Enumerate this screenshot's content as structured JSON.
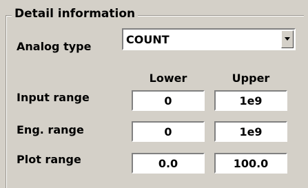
{
  "group": {
    "title": "Detail information"
  },
  "analog_type": {
    "label": "Analog type",
    "value": "COUNT"
  },
  "columns": {
    "lower": "Lower",
    "upper": "Upper"
  },
  "rows": [
    {
      "label": "Input range",
      "lower": "0",
      "upper": "1e9"
    },
    {
      "label": "Eng. range",
      "lower": "0",
      "upper": "1e9"
    },
    {
      "label": "Plot range",
      "lower": "0.0",
      "upper": "100.0"
    }
  ],
  "icons": {
    "dropdown": "chevron-down-icon"
  }
}
